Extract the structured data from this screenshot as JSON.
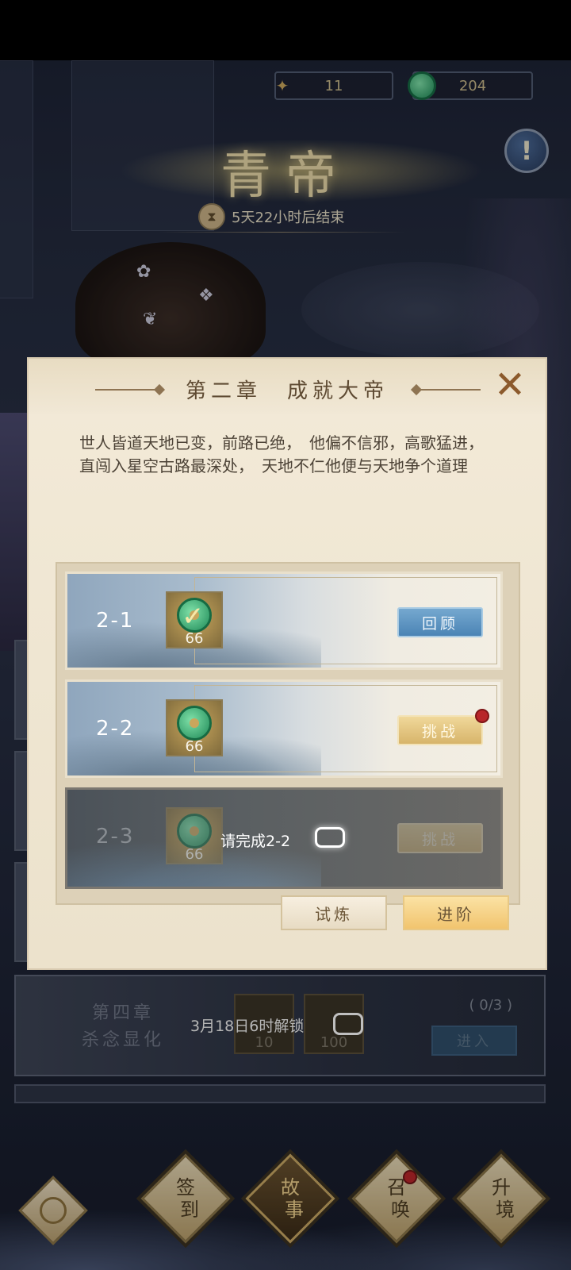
{
  "resources": [
    {
      "icon": "scroll-icon",
      "value": "11"
    },
    {
      "icon": "jade-icon",
      "value": "204"
    }
  ],
  "event": {
    "title": "青帝",
    "timer": "5天22小时后结束"
  },
  "modal": {
    "title": "第二章　成就大帝",
    "close_label": "✕",
    "description": "世人皆道天地已变，前路已绝，　他偏不信邪，高歌猛进，直闯入星空古路最深处，　天地不仁他便与天地争个道理",
    "levels": [
      {
        "id": "2-1",
        "reward": "66",
        "status": "completed",
        "button": "回顾"
      },
      {
        "id": "2-2",
        "reward": "66",
        "status": "available",
        "button": "挑战"
      },
      {
        "id": "2-3",
        "reward": "66",
        "status": "locked",
        "button": "挑战",
        "lock_text": "请完成2-2"
      }
    ],
    "buttons": {
      "trial": "试炼",
      "advance": "进阶"
    }
  },
  "chapter4": {
    "name_line1": "第四章",
    "name_line2": "杀念显化",
    "rewards": [
      "10",
      "100"
    ],
    "progress": "( 0/3 )",
    "enter": "进入",
    "unlock_text": "3月18日6时解锁"
  },
  "nav": [
    {
      "label1": "签",
      "label2": "到",
      "active": false
    },
    {
      "label1": "故",
      "label2": "事",
      "active": true
    },
    {
      "label1": "召",
      "label2": "唤",
      "active": false,
      "badge": true
    },
    {
      "label1": "升",
      "label2": "境",
      "active": false
    }
  ],
  "colors": {
    "accent_gold": "#e8d9a8",
    "review_blue": "#4b84b5",
    "challenge_gold": "#d7b46a",
    "badge_red": "#b8262a"
  }
}
